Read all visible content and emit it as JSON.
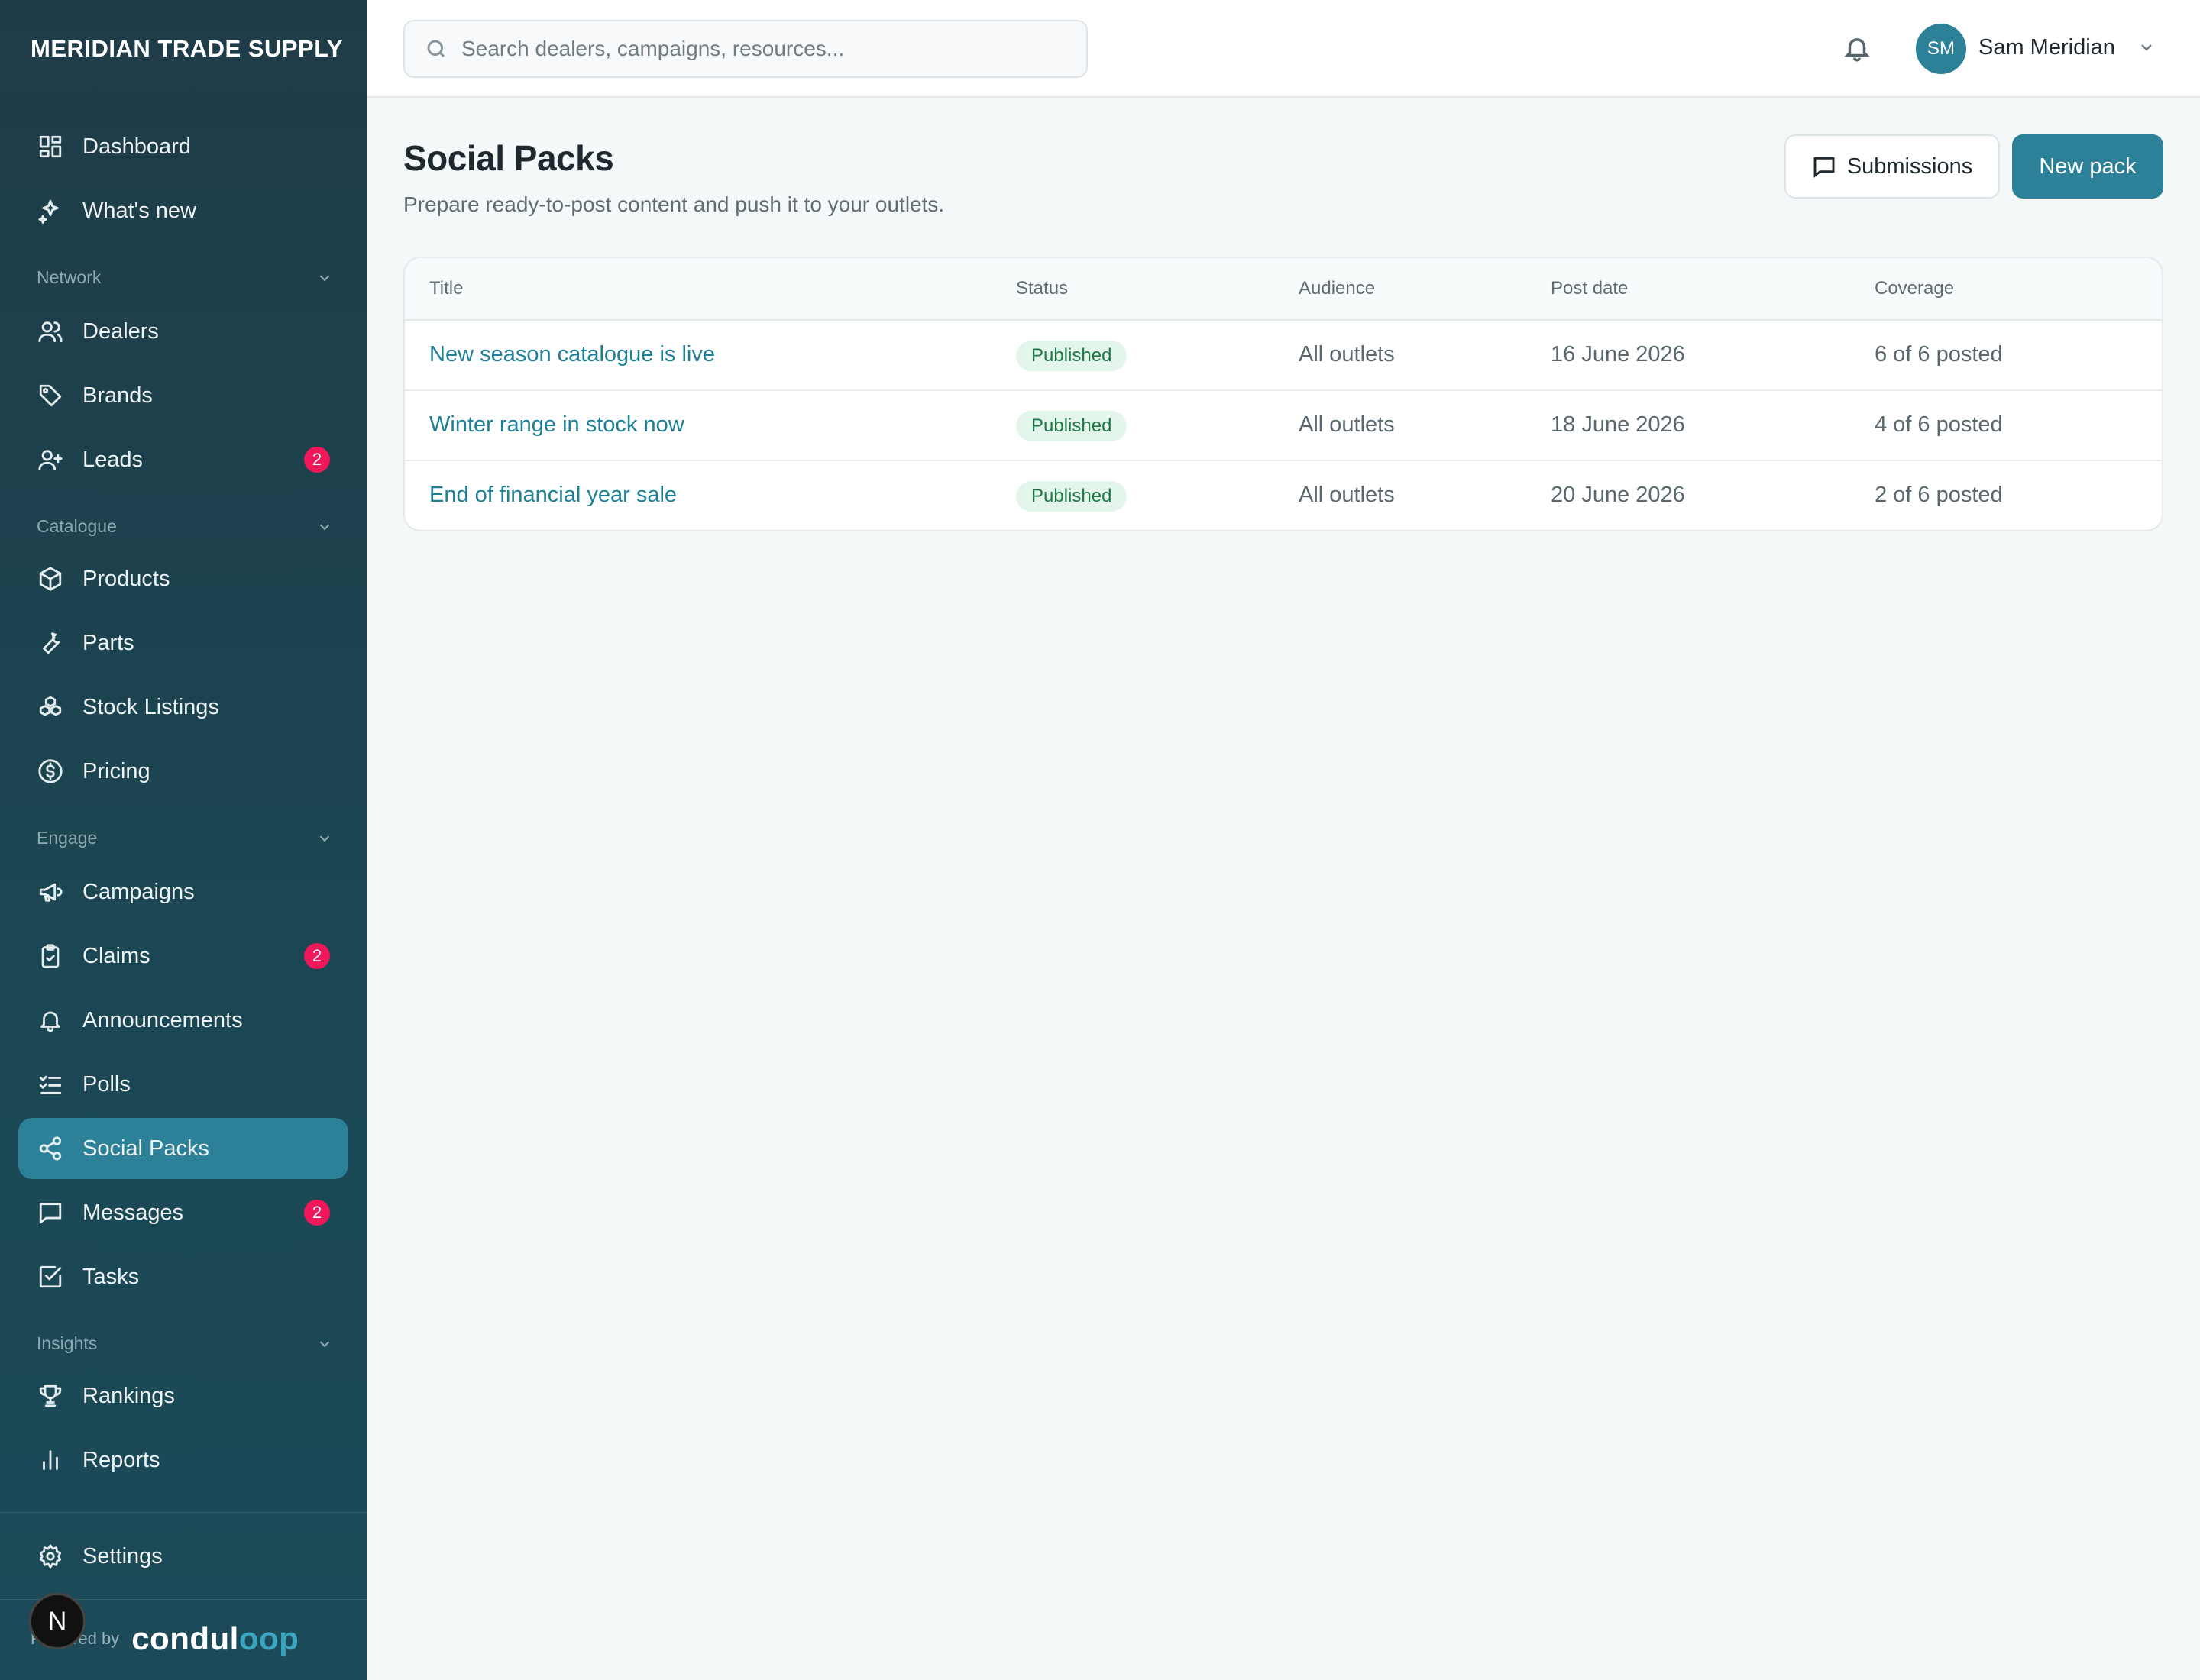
{
  "brand": "MERIDIAN TRADE SUPPLY",
  "nav": {
    "top": [
      {
        "label": "Dashboard",
        "icon": "dashboard-icon"
      },
      {
        "label": "What's new",
        "icon": "sparkles-icon"
      }
    ],
    "sections": [
      {
        "title": "Network",
        "items": [
          {
            "label": "Dealers",
            "icon": "users-icon"
          },
          {
            "label": "Brands",
            "icon": "tag-icon"
          },
          {
            "label": "Leads",
            "icon": "user-plus-icon",
            "badge": "2"
          }
        ]
      },
      {
        "title": "Catalogue",
        "items": [
          {
            "label": "Products",
            "icon": "box-icon"
          },
          {
            "label": "Parts",
            "icon": "wrench-icon"
          },
          {
            "label": "Stock Listings",
            "icon": "boxes-icon"
          },
          {
            "label": "Pricing",
            "icon": "dollar-icon"
          }
        ]
      },
      {
        "title": "Engage",
        "items": [
          {
            "label": "Campaigns",
            "icon": "megaphone-icon"
          },
          {
            "label": "Claims",
            "icon": "clipboard-icon",
            "badge": "2"
          },
          {
            "label": "Announcements",
            "icon": "bell-icon"
          },
          {
            "label": "Polls",
            "icon": "checklist-icon"
          },
          {
            "label": "Social Packs",
            "icon": "share-icon",
            "active": true
          },
          {
            "label": "Messages",
            "icon": "message-icon",
            "badge": "2"
          },
          {
            "label": "Tasks",
            "icon": "check-square-icon"
          }
        ]
      },
      {
        "title": "Insights",
        "items": [
          {
            "label": "Rankings",
            "icon": "trophy-icon"
          },
          {
            "label": "Reports",
            "icon": "bar-chart-icon"
          }
        ]
      }
    ],
    "settings": "Settings",
    "powered_by": "Powered by",
    "logo_text_a": "condul",
    "logo_text_b": "oop"
  },
  "topbar": {
    "search_placeholder": "Search dealers, campaigns, resources...",
    "user_initials": "SM",
    "user_name": "Sam Meridian"
  },
  "page": {
    "title": "Social Packs",
    "subtitle": "Prepare ready-to-post content and push it to your outlets.",
    "submissions_label": "Submissions",
    "new_pack_label": "New pack"
  },
  "table": {
    "headers": [
      "Title",
      "Status",
      "Audience",
      "Post date",
      "Coverage"
    ],
    "rows": [
      {
        "title": "New season catalogue is live",
        "status": "Published",
        "audience": "All outlets",
        "post_date": "16 June 2026",
        "coverage": "6 of 6 posted"
      },
      {
        "title": "Winter range in stock now",
        "status": "Published",
        "audience": "All outlets",
        "post_date": "18 June 2026",
        "coverage": "4 of 6 posted"
      },
      {
        "title": "End of financial year sale",
        "status": "Published",
        "audience": "All outlets",
        "post_date": "20 June 2026",
        "coverage": "2 of 6 posted"
      }
    ]
  },
  "dev_badge": "N"
}
